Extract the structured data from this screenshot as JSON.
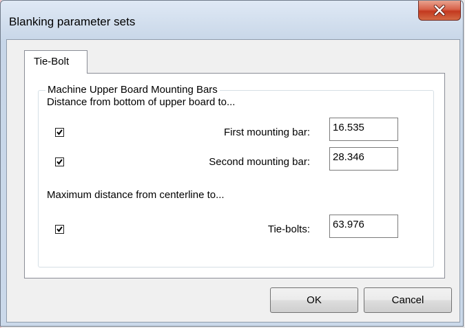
{
  "window": {
    "title": "Blanking parameter sets",
    "close_icon": "close-icon"
  },
  "tabs": [
    {
      "label": "Tie-Bolt",
      "selected": true
    }
  ],
  "group": {
    "label": "Machine Upper Board Mounting Bars",
    "section1_heading": "Distance from bottom of upper board to...",
    "section2_heading": "Maximum distance from centerline to..."
  },
  "fields": [
    {
      "label": "First mounting bar:",
      "value": "16.535",
      "checked": true
    },
    {
      "label": "Second mounting bar:",
      "value": "28.346",
      "checked": true
    },
    {
      "label": "Tie-bolts:",
      "value": "63.976",
      "checked": true
    }
  ],
  "buttons": {
    "ok": "OK",
    "cancel": "Cancel"
  }
}
